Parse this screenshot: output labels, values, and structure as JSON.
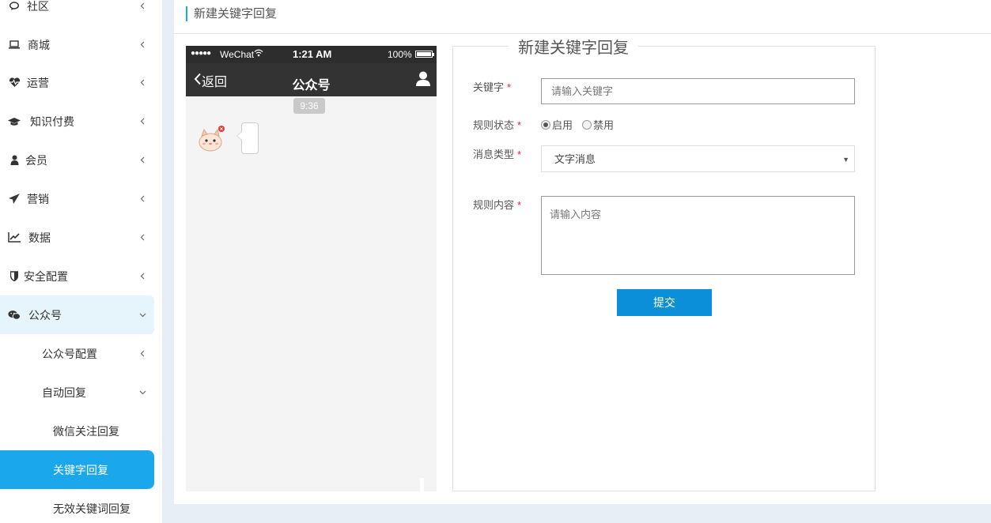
{
  "sidebar": {
    "items": [
      {
        "label": "社区",
        "icon": "comment-icon"
      },
      {
        "label": "商城",
        "icon": "laptop-icon"
      },
      {
        "label": "运营",
        "icon": "heartbeat-icon"
      },
      {
        "label": "知识付费",
        "icon": "graduation-cap-icon"
      },
      {
        "label": "会员",
        "icon": "user-icon"
      },
      {
        "label": "营销",
        "icon": "paper-plane-icon"
      },
      {
        "label": "数据",
        "icon": "line-chart-icon"
      },
      {
        "label": "安全配置",
        "icon": "shield-icon"
      },
      {
        "label": "公众号",
        "icon": "wechat-icon"
      }
    ],
    "sub_items": [
      {
        "label": "公众号配置"
      },
      {
        "label": "自动回复"
      }
    ],
    "leaf_items": [
      {
        "label": "微信关注回复"
      },
      {
        "label": "关键字回复"
      },
      {
        "label": "无效关键词回复"
      }
    ]
  },
  "header": {
    "title": "新建关键字回复"
  },
  "phone": {
    "signal": "●●●●●",
    "carrier": "WeChat",
    "time": "1:21 AM",
    "battery": "100%",
    "battery_level": 1.0,
    "back_label": "返回",
    "title": "公众号",
    "msg_time": "9:36"
  },
  "form": {
    "legend": "新建关键字回复",
    "keyword_label": "关键字",
    "keyword_placeholder": "请输入关键字",
    "status_label": "规则状态",
    "status_options": [
      "启用",
      "禁用"
    ],
    "status_selected": "启用",
    "type_label": "消息类型",
    "type_value": "文字消息",
    "content_label": "规则内容",
    "content_placeholder": "请输入内容",
    "required_mark": "*",
    "submit_label": "提交"
  },
  "colors": {
    "accent": "#1aa7ec",
    "submit": "#0a8fd8",
    "required": "#ee2233",
    "phone_bar": "#2d2d2d"
  }
}
